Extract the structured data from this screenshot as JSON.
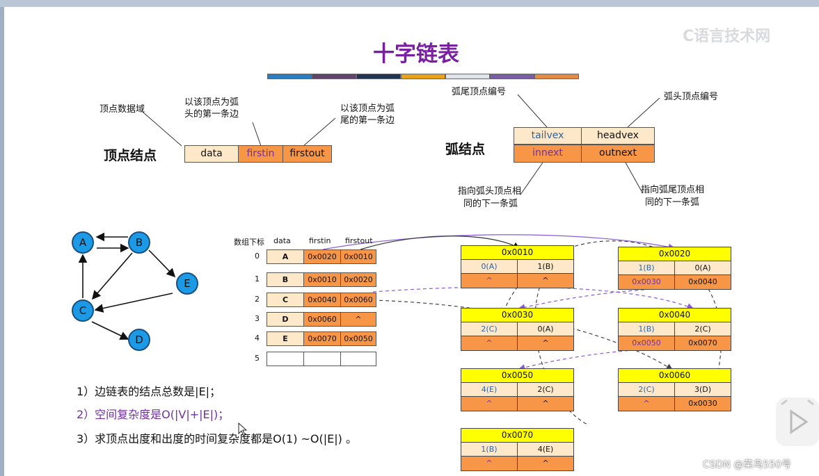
{
  "title": "十字链表",
  "colors": {
    "title": "#7a1fa0",
    "beige": "#fde9c9",
    "orange": "#f79646",
    "yellow": "#ffff00",
    "node_blue": "#1c9ae6",
    "purple_text": "#7030a0",
    "bar": [
      "#2b7dc1",
      "#61436b",
      "#1e3553",
      "#e8a11a",
      "#dfe3ea",
      "#7a5ea3",
      "#e38a45"
    ]
  },
  "vertex_node": {
    "heading": "顶点结点",
    "fields": [
      "data",
      "firstin",
      "firstout"
    ],
    "callouts": {
      "data": "顶点数据域",
      "firstin": [
        "以该顶点为弧",
        "头的第一条边"
      ],
      "firstout": [
        "以该顶点为弧",
        "尾的第一条边"
      ]
    }
  },
  "arc_node": {
    "heading": "弧结点",
    "fields_row1": [
      "tailvex",
      "headvex"
    ],
    "fields_row2": [
      "innext",
      "outnext"
    ],
    "callouts": {
      "tailvex": "弧尾顶点编号",
      "headvex": "弧头顶点编号",
      "innext": [
        "指向弧头顶点相",
        "同的下一条弧"
      ],
      "outnext": [
        "指向弧尾顶点相",
        "同的下一条弧"
      ]
    }
  },
  "graph": {
    "nodes": [
      "A",
      "B",
      "C",
      "D",
      "E"
    ]
  },
  "vertex_table": {
    "headers": [
      "数组下标",
      "data",
      "firstin",
      "firstout"
    ],
    "rows": [
      {
        "index": "0",
        "data": "A",
        "firstin": "0x0020",
        "firstout": "0x0010"
      },
      {
        "index": "1",
        "data": "B",
        "firstin": "0x0010",
        "firstout": "0x0020"
      },
      {
        "index": "2",
        "data": "C",
        "firstin": "0x0040",
        "firstout": "0x0060"
      },
      {
        "index": "3",
        "data": "D",
        "firstin": "0x0060",
        "firstout": "^"
      },
      {
        "index": "4",
        "data": "E",
        "firstin": "0x0070",
        "firstout": "0x0050"
      },
      {
        "index": "5",
        "data": "",
        "firstin": "",
        "firstout": ""
      }
    ]
  },
  "arc_nodes": [
    {
      "addr": "0x0010",
      "tail": "0(A)",
      "head": "1(B)",
      "innext": "^",
      "outnext": "^"
    },
    {
      "addr": "0x0020",
      "tail": "1(B)",
      "head": "0(A)",
      "innext": "0x0030",
      "outnext": "0x0040"
    },
    {
      "addr": "0x0030",
      "tail": "2(C)",
      "head": "0(A)",
      "innext": "^",
      "outnext": "^"
    },
    {
      "addr": "0x0040",
      "tail": "1(B)",
      "head": "2(C)",
      "innext": "0x0050",
      "outnext": "0x0070"
    },
    {
      "addr": "0x0050",
      "tail": "4(E)",
      "head": "2(C)",
      "innext": "^",
      "outnext": "^"
    },
    {
      "addr": "0x0060",
      "tail": "2(C)",
      "head": "3(D)",
      "innext": "^",
      "outnext": "0x0030"
    },
    {
      "addr": "0x0070",
      "tail": "1(B)",
      "head": "4(E)",
      "innext": "^",
      "outnext": "^"
    }
  ],
  "notes": [
    "1）边链表的结点总数是|E|；",
    "2）空间复杂度是O(|V|+|E|)；",
    "3）求顶点出度和出度的时间复杂度都是O(1) ~O(|E|) 。"
  ],
  "watermark": "C语言技术网",
  "csdn": "CSDN @菜鸟550号"
}
